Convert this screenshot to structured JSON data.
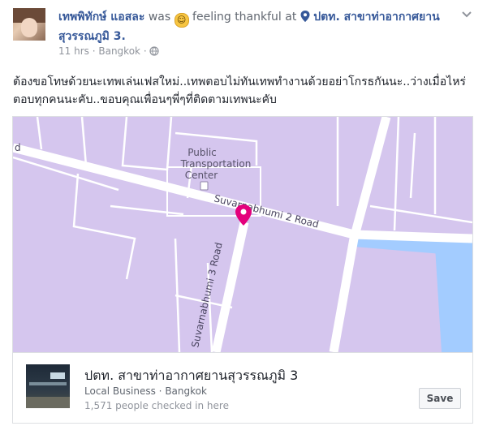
{
  "post": {
    "author": "เทพพิทักษ์ แอสละ",
    "activity_word": "was",
    "feeling": "feeling thankful at",
    "place_link": "ปตท. สาขาท่าอากาศยานสุวรรณภูมิ 3.",
    "time": "11 hrs",
    "location": "Bangkok",
    "separator": "·",
    "text": "ต้องขอโทษด้วยนะเทพเล่นเฟสใหม่..เทพตอบไม่ทันเทพทำงานด้วยอย่าโกรธกันนะ..ว่างเมื่อไหร่ตอบทุกคนนะคับ..ขอบคุณเพื่อนๆพี่ๆที่ติดตามเทพนะคับ"
  },
  "map": {
    "label_public": "Public",
    "label_transport": "Transportation",
    "label_center": "Center",
    "road_main": "Suvarnabhumi 2 Road",
    "road_side": "Suvarnabhumi 3 Road",
    "edge_letter": "d",
    "pin_color": "#e4007c",
    "land_color": "#d5c6ee",
    "road_color": "#ffffff",
    "water_color": "#a3ccff"
  },
  "place": {
    "name": "ปตท. สาขาท่าอากาศยานสุวรรณภูมิ 3",
    "category": "Local Business",
    "city": "Bangkok",
    "checkins": "1,571 people checked in here",
    "save_label": "Save"
  },
  "icons": {
    "emoji": "smiley-emoji",
    "pin": "location-pin-icon",
    "globe": "globe-icon",
    "chevron": "chevron-down-icon"
  }
}
